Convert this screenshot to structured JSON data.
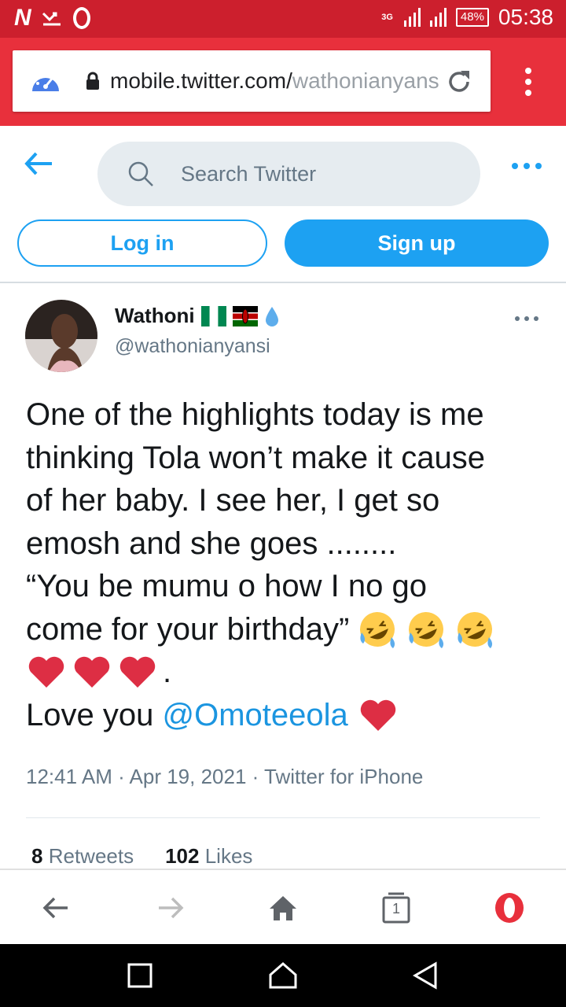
{
  "status_bar": {
    "network_type": "3G",
    "battery": "48%",
    "time": "05:38",
    "left_icons": [
      "n-notification-icon",
      "missed-call-icon",
      "opera-notification-icon"
    ]
  },
  "browser": {
    "url_domain": "mobile.twitter.com/",
    "url_path": "wathonianyansi/status",
    "icons": [
      "speed-dial-icon",
      "lock-icon",
      "reload-icon",
      "overflow-menu-icon"
    ]
  },
  "twitter_header": {
    "search_placeholder": "Search Twitter",
    "login_label": "Log in",
    "signup_label": "Sign up"
  },
  "tweet": {
    "display_name": "Wathoni",
    "handle": "@wathonianyansi",
    "badges": [
      "nigeria-flag-icon",
      "kenya-flag-icon",
      "droplet-icon"
    ],
    "text_lines": [
      "One of the highlights today is me",
      "thinking Tola won’t make it cause",
      "of her baby. I see her, I get so",
      "emosh and she goes ........",
      "“You be mumu o how I no go",
      "come for your birthday”"
    ],
    "period_after_hearts": ".",
    "love_prefix": "Love you ",
    "mention": "@Omoteeola",
    "emojis": [
      "rolling-laughing-emoji",
      "red-heart-emoji"
    ],
    "timestamp": "12:41 AM · Apr 19, 2021 · Twitter for iPhone",
    "retweets_count": "8",
    "retweets_label": "Retweets",
    "likes_count": "102",
    "likes_label": "Likes"
  },
  "bottom_nav": {
    "tab_count": "1",
    "icons": [
      "back-icon",
      "forward-icon",
      "home-icon",
      "tabs-icon",
      "opera-menu-icon"
    ]
  },
  "colors": {
    "status_bar": "#cc1f2d",
    "browser_bar": "#e8303c",
    "twitter_blue": "#1da1f2",
    "mention_blue": "#1b95e0",
    "secondary_text": "#657786",
    "search_bg": "#e6ecf0",
    "heart_red": "#dd2e44",
    "emoji_yellow": "#ffcc4d"
  }
}
